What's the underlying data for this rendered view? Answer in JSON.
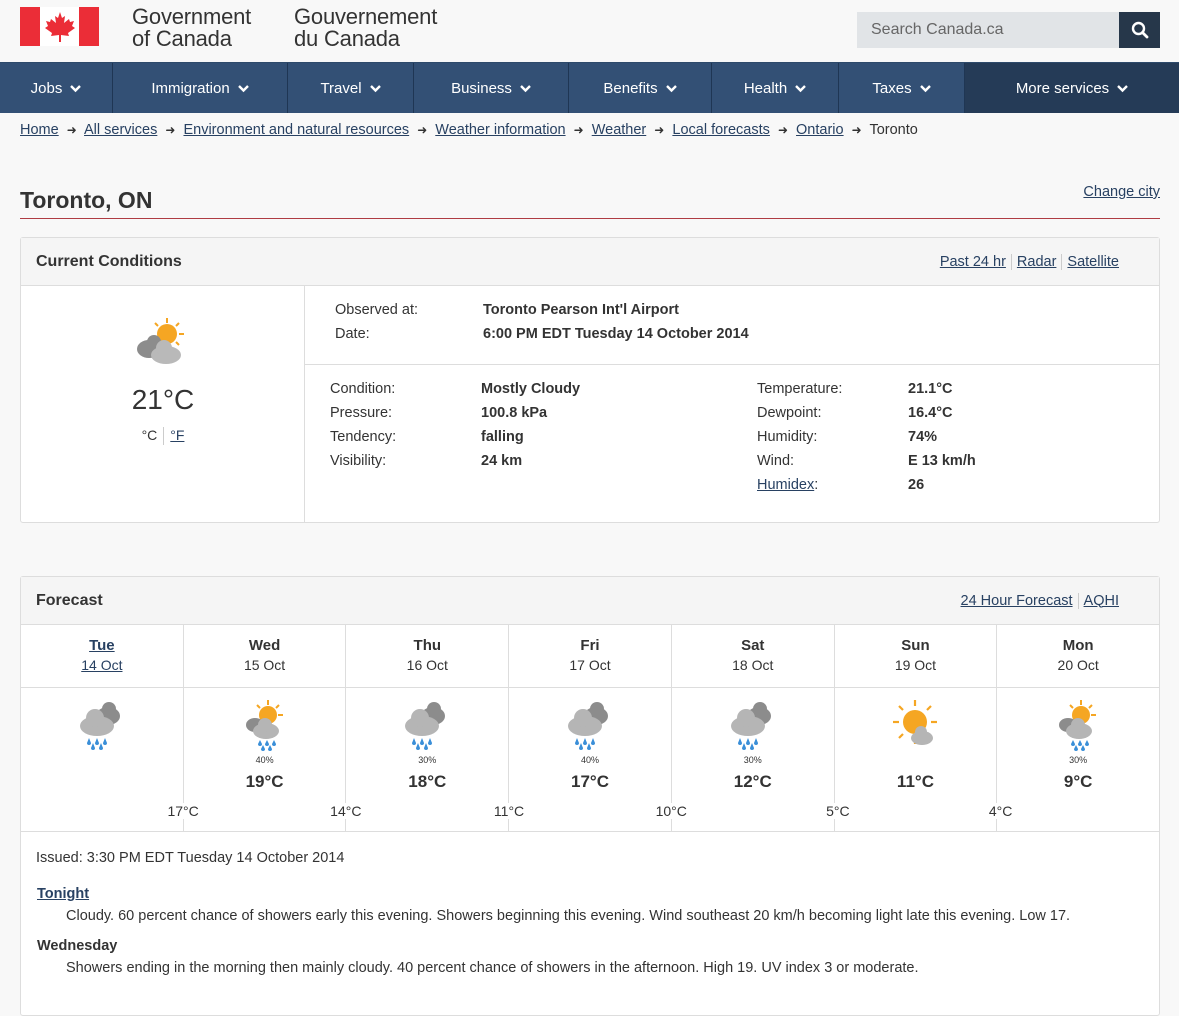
{
  "header": {
    "signature_en_1": "Government",
    "signature_en_2": "of Canada",
    "signature_fr_1": "Gouvernement",
    "signature_fr_2": "du Canada",
    "search_placeholder": "Search Canada.ca",
    "search_icon": "magnifier-icon"
  },
  "nav": [
    {
      "label": "Jobs"
    },
    {
      "label": "Immigration"
    },
    {
      "label": "Travel"
    },
    {
      "label": "Business"
    },
    {
      "label": "Benefits"
    },
    {
      "label": "Health"
    },
    {
      "label": "Taxes"
    },
    {
      "label": "More services"
    }
  ],
  "breadcrumb": [
    {
      "label": "Home"
    },
    {
      "label": "All services"
    },
    {
      "label": "Environment and natural resources"
    },
    {
      "label": "Weather information"
    },
    {
      "label": "Weather"
    },
    {
      "label": "Local forecasts"
    },
    {
      "label": "Ontario"
    },
    {
      "label": "Toronto"
    }
  ],
  "page": {
    "title": "Toronto, ON",
    "change_city": "Change city"
  },
  "current": {
    "heading": "Current Conditions",
    "links": [
      "Past 24 hr",
      "Radar",
      "Satellite"
    ],
    "icon": "sun-behind-clouds-icon",
    "temp": "21°C",
    "unit_c": "°C",
    "unit_f": "°F",
    "observed_label": "Observed at:",
    "observed_value": "Toronto Pearson Int'l Airport",
    "date_label": "Date:",
    "date_value": "6:00 PM EDT Tuesday 14 October 2014",
    "left_rows": [
      {
        "label": "Condition:",
        "value": "Mostly Cloudy"
      },
      {
        "label": "Pressure:",
        "value": "100.8 kPa"
      },
      {
        "label": "Tendency:",
        "value": "falling"
      },
      {
        "label": "Visibility:",
        "value": "24 km"
      }
    ],
    "right_rows": [
      {
        "label": "Temperature:",
        "value": "21.1°C"
      },
      {
        "label": "Dewpoint:",
        "value": "16.4°C"
      },
      {
        "label": "Humidity:",
        "value": "74%"
      },
      {
        "label": "Wind:",
        "value": "E 13 km/h"
      },
      {
        "label": "Humidex",
        "value": "26"
      }
    ]
  },
  "forecast": {
    "heading": "Forecast",
    "links": [
      "24 Hour Forecast",
      "AQHI"
    ],
    "days": [
      {
        "name": "Tue",
        "date": "14 Oct",
        "icon": "rain-cloud-icon",
        "pop": "",
        "high": "",
        "low": "17°C"
      },
      {
        "name": "Wed",
        "date": "15 Oct",
        "icon": "sun-cloud-showers-icon",
        "pop": "40%",
        "high": "19°C",
        "low": "14°C"
      },
      {
        "name": "Thu",
        "date": "16 Oct",
        "icon": "rain-cloud-icon",
        "pop": "30%",
        "high": "18°C",
        "low": "11°C"
      },
      {
        "name": "Fri",
        "date": "17 Oct",
        "icon": "rain-cloud-icon",
        "pop": "40%",
        "high": "17°C",
        "low": "10°C"
      },
      {
        "name": "Sat",
        "date": "18 Oct",
        "icon": "rain-cloud-icon",
        "pop": "30%",
        "high": "12°C",
        "low": "5°C"
      },
      {
        "name": "Sun",
        "date": "19 Oct",
        "icon": "sun-cloud-icon",
        "pop": "",
        "high": "11°C",
        "low": "4°C"
      },
      {
        "name": "Mon",
        "date": "20 Oct",
        "icon": "sun-cloud-showers-icon",
        "pop": "30%",
        "high": "9°C",
        "low": ""
      }
    ],
    "issued": "Issued: 3:30 PM EDT Tuesday 14 October 2014",
    "periods": [
      {
        "title": "Tonight",
        "text": "Cloudy. 60 percent chance of showers early this evening. Showers beginning this evening. Wind southeast 20 km/h becoming light late this evening. Low 17."
      },
      {
        "title": "Wednesday",
        "text": "Showers ending in the morning then mainly cloudy. 40 percent chance of showers in the afternoon. High 19. UV index 3 or moderate."
      }
    ]
  },
  "colors": {
    "nav_bg": "#335075",
    "nav_more_bg": "#253b57",
    "link": "#284162",
    "flag_red": "#eb2d37",
    "rule_red": "#af3c43",
    "sun": "#f5a623",
    "cloud": "#9a9a9a"
  }
}
